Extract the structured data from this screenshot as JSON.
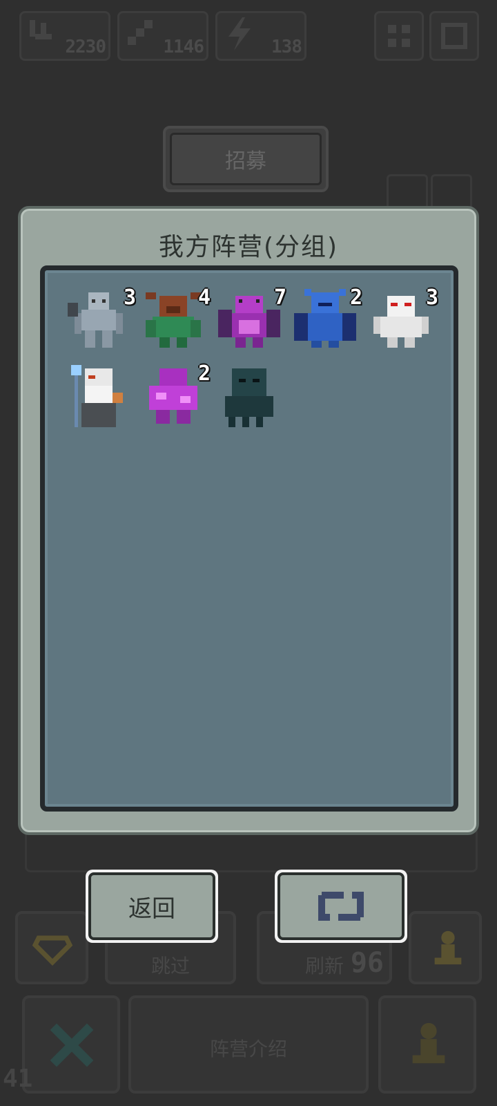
{
  "resources": [
    {
      "icon": "dagger-icon",
      "value": "2230"
    },
    {
      "icon": "sword-icon",
      "value": "1146"
    },
    {
      "icon": "lightning-icon",
      "value": "138"
    }
  ],
  "top_buttons": [
    {
      "icon": "grid-icon"
    },
    {
      "icon": "menu-icon"
    }
  ],
  "recruit": {
    "label": "招募"
  },
  "background_buttons": {
    "skip_label": "跳过",
    "refresh_label": "刷新",
    "refresh_cost": "96",
    "camp_label": "阵营介绍",
    "counter": "41"
  },
  "modal": {
    "title": "我方阵营(分组)",
    "units": [
      {
        "name": "stone-gargoyle",
        "count": "3"
      },
      {
        "name": "horned-minotaur",
        "count": "4"
      },
      {
        "name": "purple-dragon",
        "count": "7"
      },
      {
        "name": "blue-demon",
        "count": "2"
      },
      {
        "name": "white-yeti",
        "count": "3"
      },
      {
        "name": "white-beard-wizard",
        "count": ""
      },
      {
        "name": "purple-crystal-golem",
        "count": "2"
      },
      {
        "name": "dark-cthulhu",
        "count": ""
      }
    ],
    "back_label": "返回",
    "swap_icon": "swap-icon"
  },
  "colors": {
    "modal_bg": "#9aa69f",
    "roster_bg": "#5f7680",
    "text_dark": "#2d3330"
  }
}
